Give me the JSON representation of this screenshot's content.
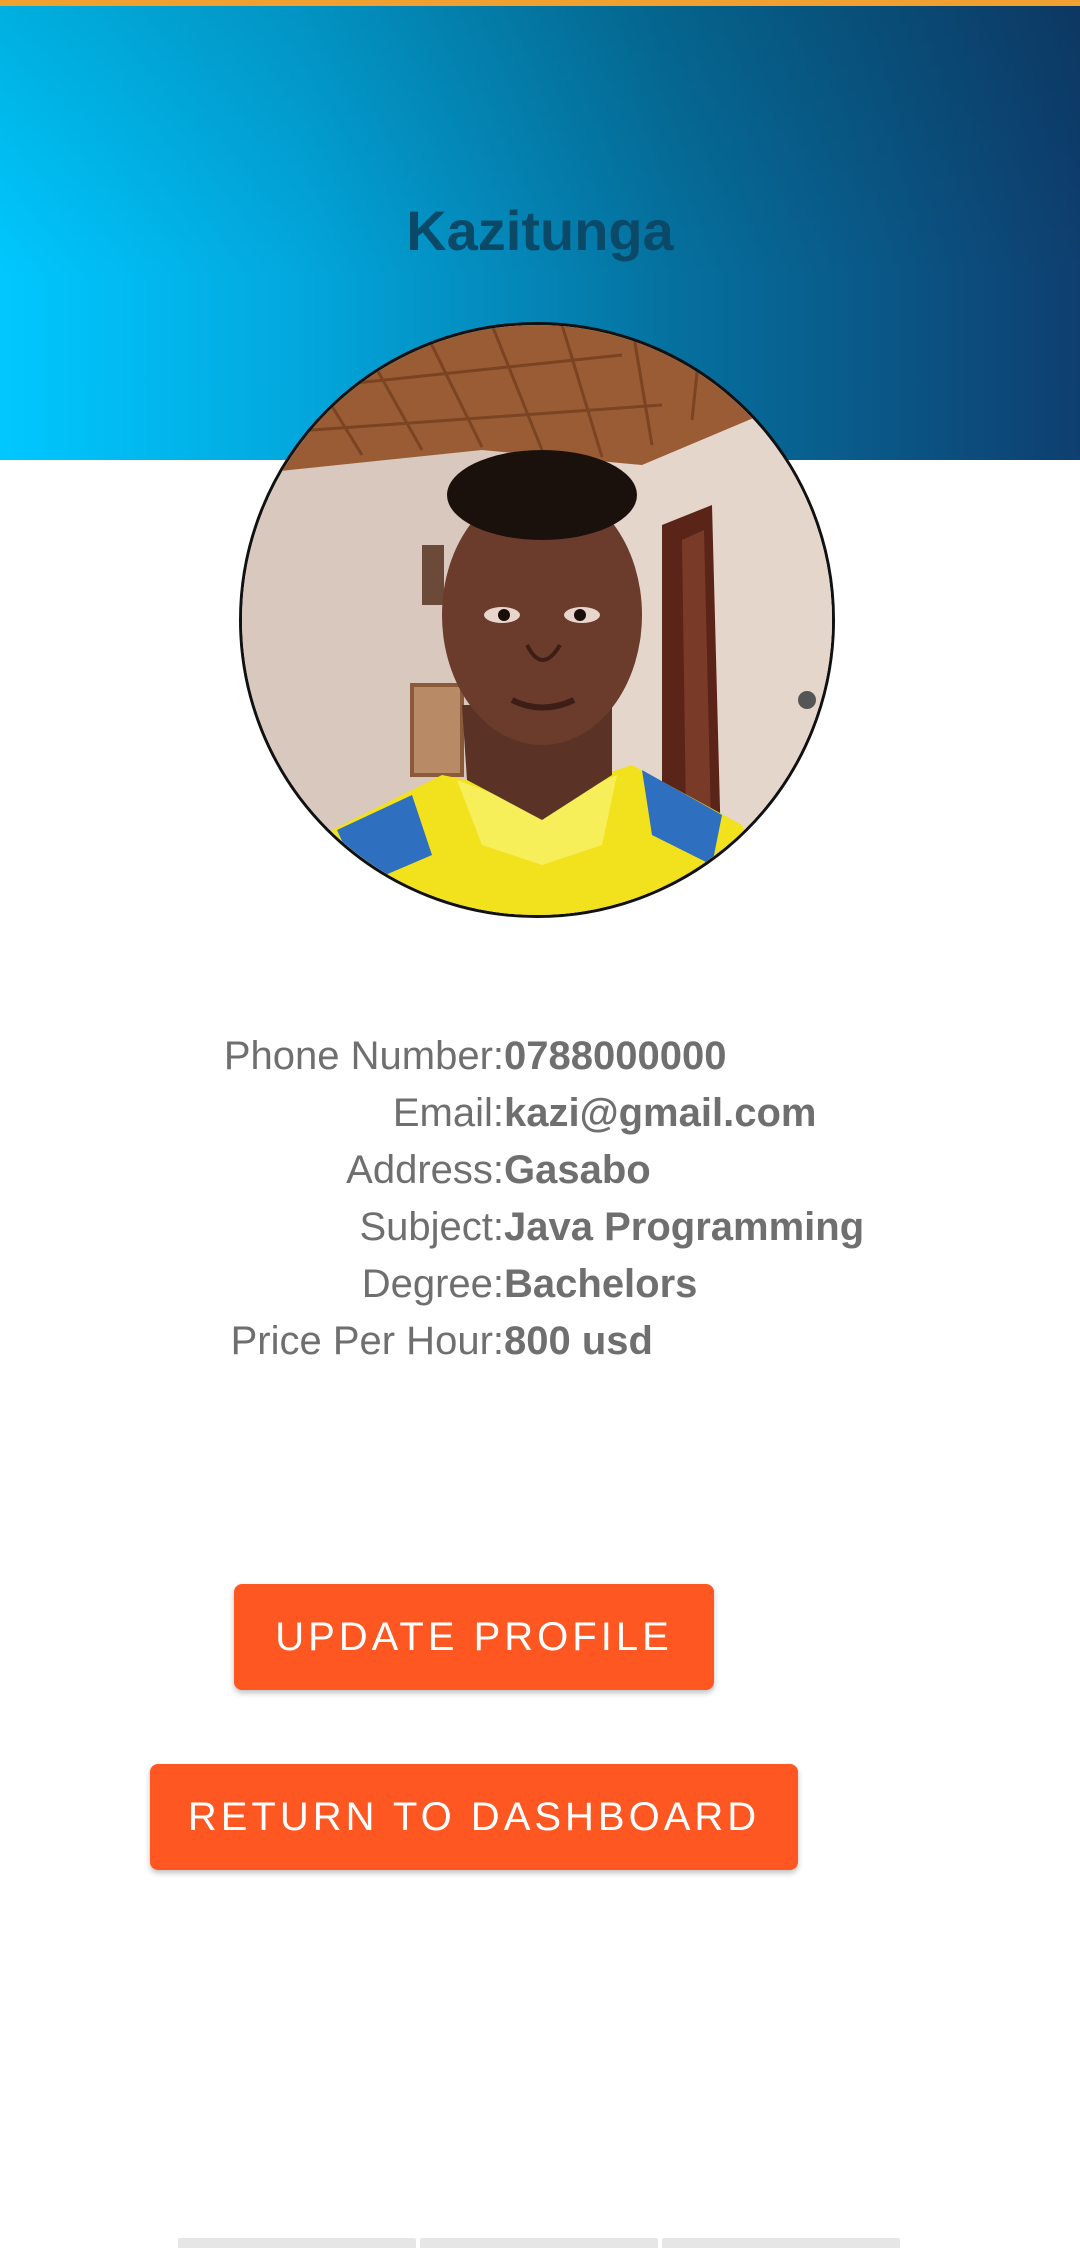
{
  "profile": {
    "name": "Kazitunga"
  },
  "info": [
    {
      "label": "Phone Number:",
      "value": "0788000000"
    },
    {
      "label": "Email:",
      "value": "kazi@gmail.com"
    },
    {
      "label": "Address:",
      "value": "Gasabo"
    },
    {
      "label": "Subject:",
      "value": "Java Programming"
    },
    {
      "label": "Degree:",
      "value": "Bachelors"
    },
    {
      "label": "Price Per Hour:",
      "value": "800 usd"
    }
  ],
  "actions": {
    "update_label": "UPDATE PROFILE",
    "dashboard_label": "RETURN TO DASHBOARD"
  },
  "colors": {
    "accent": "#ff5722",
    "header_start": "#00c8ff",
    "header_end": "#0e3f70",
    "name_text": "#0a4a68"
  }
}
